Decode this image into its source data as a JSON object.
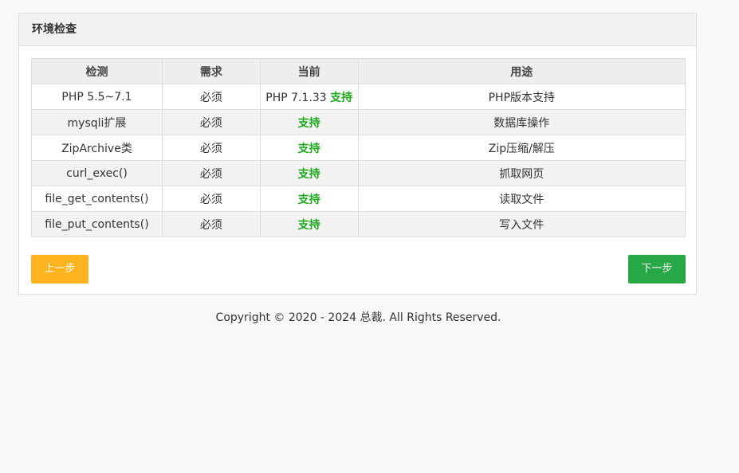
{
  "panel": {
    "title": "环境检查"
  },
  "table": {
    "headers": [
      "检测",
      "需求",
      "当前",
      "用途"
    ],
    "rows": [
      {
        "check": "PHP 5.5~7.1",
        "require": "必须",
        "current_prefix": "PHP 7.1.33",
        "current_status": "支持",
        "purpose": "PHP版本支持"
      },
      {
        "check": "mysqli扩展",
        "require": "必须",
        "current_prefix": "",
        "current_status": "支持",
        "purpose": "数据库操作"
      },
      {
        "check": "ZipArchive类",
        "require": "必须",
        "current_prefix": "",
        "current_status": "支持",
        "purpose": "Zip压缩/解压"
      },
      {
        "check": "curl_exec()",
        "require": "必须",
        "current_prefix": "",
        "current_status": "支持",
        "purpose": "抓取网页"
      },
      {
        "check": "file_get_contents()",
        "require": "必须",
        "current_prefix": "",
        "current_status": "支持",
        "purpose": "读取文件"
      },
      {
        "check": "file_put_contents()",
        "require": "必须",
        "current_prefix": "",
        "current_status": "支持",
        "purpose": "写入文件"
      }
    ]
  },
  "buttons": {
    "prev_label": "上一步",
    "next_label": "下一步"
  },
  "footer": {
    "copyright": "Copyright © 2020 - 2024 总裁. All Rights Reserved."
  },
  "colors": {
    "ok_green": "#1aaa1a",
    "prev_bg": "#ffb41f",
    "next_bg": "#28a745"
  }
}
